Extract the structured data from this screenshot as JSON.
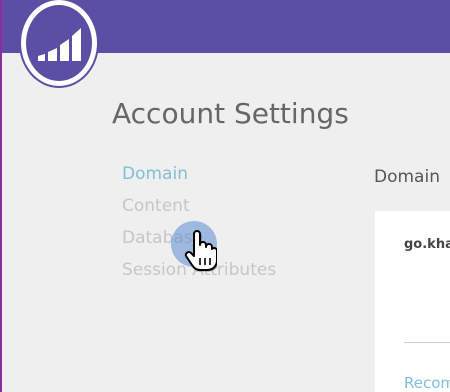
{
  "app": {
    "brand_icon": "marketo-bars-logo",
    "accent_color": "#5b4fa5"
  },
  "page": {
    "title": "Account Settings"
  },
  "nav": {
    "items": [
      {
        "label": "Domain",
        "active": true
      },
      {
        "label": "Content",
        "active": false
      },
      {
        "label": "Database",
        "active": false
      },
      {
        "label": "Session Attributes",
        "active": false
      }
    ]
  },
  "content": {
    "heading": "Domain",
    "domain_value": "go.kha",
    "link_text": "Recom"
  },
  "pointer": {
    "icon": "hand-pointer-icon"
  }
}
